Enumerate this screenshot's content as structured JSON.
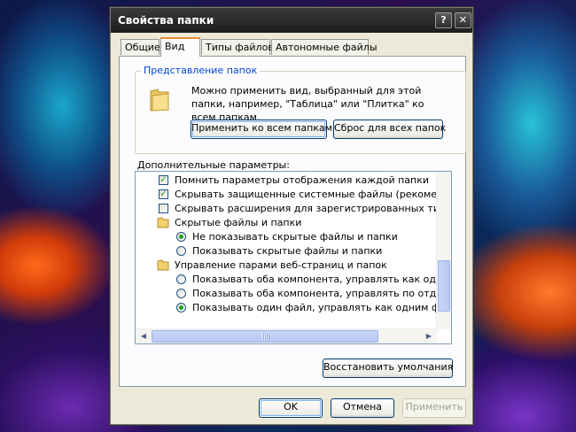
{
  "window": {
    "title": "Свойства папки",
    "help_label": "?",
    "close_label": "✕"
  },
  "tabs": [
    {
      "label": "Общие",
      "active": false
    },
    {
      "label": "Вид",
      "active": true
    },
    {
      "label": "Типы файлов",
      "active": false
    },
    {
      "label": "Автономные файлы",
      "active": false
    }
  ],
  "folder_views": {
    "legend": "Представление папок",
    "description": "Можно применить вид, выбранный для этой папки, например, \"Таблица\" или \"Плитка\" ко всем папкам.",
    "apply_button": "Применить ко всем папкам",
    "reset_button": "Сброс для всех папок",
    "icon": "folder-icon"
  },
  "advanced": {
    "label": "Дополнительные параметры:",
    "items": [
      {
        "kind": "checkbox",
        "checked": true,
        "indent": 1,
        "text": "Помнить параметры отображения каждой папки"
      },
      {
        "kind": "checkbox",
        "checked": true,
        "indent": 1,
        "text": "Скрывать защищенные системные файлы (рекомендуется)"
      },
      {
        "kind": "checkbox",
        "checked": false,
        "indent": 1,
        "text": "Скрывать расширения для зарегистрированных типов файлов"
      },
      {
        "kind": "folder",
        "indent": 1,
        "text": "Скрытые файлы и папки"
      },
      {
        "kind": "radio",
        "checked": true,
        "indent": 2,
        "text": "Не показывать скрытые файлы и папки"
      },
      {
        "kind": "radio",
        "checked": false,
        "indent": 2,
        "text": "Показывать скрытые файлы и папки"
      },
      {
        "kind": "folder",
        "indent": 1,
        "text": "Управление парами веб-страниц и папок"
      },
      {
        "kind": "radio",
        "checked": false,
        "indent": 2,
        "text": "Показывать оба компонента, управлять как одним файлом"
      },
      {
        "kind": "radio",
        "checked": false,
        "indent": 2,
        "text": "Показывать оба компонента, управлять по отдельности"
      },
      {
        "kind": "radio",
        "checked": true,
        "indent": 2,
        "text": "Показывать один файл, управлять как одним файлом"
      }
    ]
  },
  "restore_button": "Восстановить умолчания",
  "footer": {
    "ok": "OK",
    "cancel": "Отмена",
    "apply": "Применить"
  }
}
